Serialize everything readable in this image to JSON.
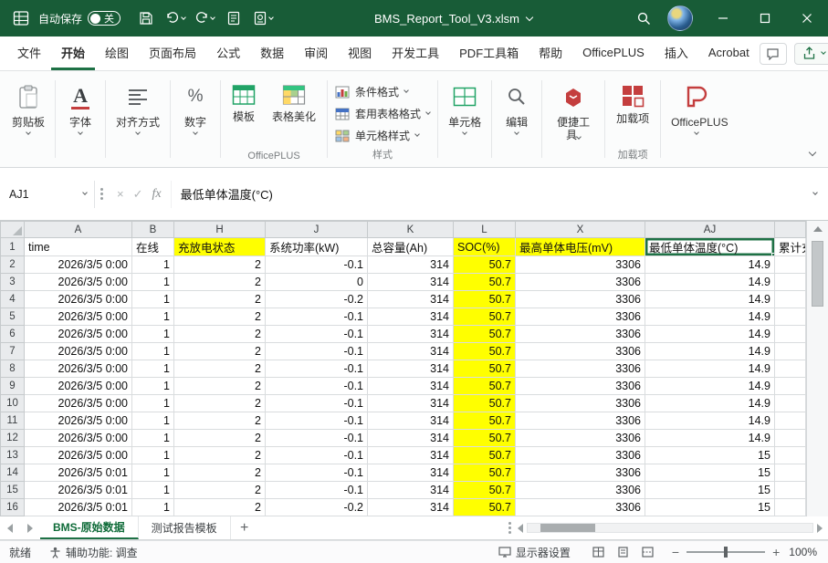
{
  "titlebar": {
    "autosave_label": "自动保存",
    "autosave_state": "关",
    "filename": "BMS_Report_Tool_V3.xlsm"
  },
  "menu": {
    "tabs": [
      "文件",
      "开始",
      "绘图",
      "页面布局",
      "公式",
      "数据",
      "审阅",
      "视图",
      "开发工具",
      "PDF工具箱",
      "帮助",
      "OfficePLUS",
      "插入",
      "Acrobat"
    ],
    "active_tab": "开始"
  },
  "ribbon": {
    "clipboard_label": "剪贴板",
    "font_label": "字体",
    "font_glyph": "A",
    "alignment_label": "对齐方式",
    "number_label": "数字",
    "number_glyph": "%",
    "template_label": "模板",
    "table_beautify_label": "表格美化",
    "officeplus_group_label": "OfficePLUS",
    "conditional_format_label": "条件格式",
    "format_as_table_label": "套用表格格式",
    "cell_styles_label": "单元格样式",
    "styles_group_label": "样式",
    "cells_label": "单元格",
    "editing_label": "编辑",
    "handy_tools_label": "便捷工具",
    "addins_label": "加载项",
    "officeplus_button_label": "OfficePLUS"
  },
  "formula_bar": {
    "name_box": "AJ1",
    "fx_label": "fx",
    "content": "最低单体温度(°C)"
  },
  "grid": {
    "columns": [
      "A",
      "B",
      "H",
      "J",
      "K",
      "L",
      "X",
      "AJ",
      ""
    ],
    "header_row": [
      "time",
      "在线",
      "充放电状态",
      "系统功率(kW)",
      "总容量(Ah)",
      "SOC(%)",
      "最高单体电压(mV)",
      "最低单体温度(°C)",
      "累计充"
    ],
    "rows": [
      {
        "n": 2,
        "cells": [
          "2026/3/5 0:00",
          "1",
          "2",
          "-0.1",
          "314",
          "50.7",
          "3306",
          "14.9",
          ""
        ]
      },
      {
        "n": 3,
        "cells": [
          "2026/3/5 0:00",
          "1",
          "2",
          "0",
          "314",
          "50.7",
          "3306",
          "14.9",
          ""
        ]
      },
      {
        "n": 4,
        "cells": [
          "2026/3/5 0:00",
          "1",
          "2",
          "-0.2",
          "314",
          "50.7",
          "3306",
          "14.9",
          ""
        ]
      },
      {
        "n": 5,
        "cells": [
          "2026/3/5 0:00",
          "1",
          "2",
          "-0.1",
          "314",
          "50.7",
          "3306",
          "14.9",
          ""
        ]
      },
      {
        "n": 6,
        "cells": [
          "2026/3/5 0:00",
          "1",
          "2",
          "-0.1",
          "314",
          "50.7",
          "3306",
          "14.9",
          ""
        ]
      },
      {
        "n": 7,
        "cells": [
          "2026/3/5 0:00",
          "1",
          "2",
          "-0.1",
          "314",
          "50.7",
          "3306",
          "14.9",
          ""
        ]
      },
      {
        "n": 8,
        "cells": [
          "2026/3/5 0:00",
          "1",
          "2",
          "-0.1",
          "314",
          "50.7",
          "3306",
          "14.9",
          ""
        ]
      },
      {
        "n": 9,
        "cells": [
          "2026/3/5 0:00",
          "1",
          "2",
          "-0.1",
          "314",
          "50.7",
          "3306",
          "14.9",
          ""
        ]
      },
      {
        "n": 10,
        "cells": [
          "2026/3/5 0:00",
          "1",
          "2",
          "-0.1",
          "314",
          "50.7",
          "3306",
          "14.9",
          ""
        ]
      },
      {
        "n": 11,
        "cells": [
          "2026/3/5 0:00",
          "1",
          "2",
          "-0.1",
          "314",
          "50.7",
          "3306",
          "14.9",
          ""
        ]
      },
      {
        "n": 12,
        "cells": [
          "2026/3/5 0:00",
          "1",
          "2",
          "-0.1",
          "314",
          "50.7",
          "3306",
          "14.9",
          ""
        ]
      },
      {
        "n": 13,
        "cells": [
          "2026/3/5 0:00",
          "1",
          "2",
          "-0.1",
          "314",
          "50.7",
          "3306",
          "15",
          ""
        ]
      },
      {
        "n": 14,
        "cells": [
          "2026/3/5 0:01",
          "1",
          "2",
          "-0.1",
          "314",
          "50.7",
          "3306",
          "15",
          ""
        ]
      },
      {
        "n": 15,
        "cells": [
          "2026/3/5 0:01",
          "1",
          "2",
          "-0.1",
          "314",
          "50.7",
          "3306",
          "15",
          ""
        ]
      },
      {
        "n": 16,
        "cells": [
          "2026/3/5 0:01",
          "1",
          "2",
          "-0.2",
          "314",
          "50.7",
          "3306",
          "15",
          ""
        ]
      }
    ]
  },
  "sheets": {
    "tabs": [
      "BMS-原始数据",
      "测试报告模板"
    ],
    "active_tab": "BMS-原始数据"
  },
  "status": {
    "ready_label": "就绪",
    "accessibility_label": "辅助功能: 调查",
    "display_settings_label": "显示器设置",
    "zoom_level": "100%"
  },
  "colors": {
    "titlebar_green": "#185c37",
    "accent_green": "#1e7145",
    "highlight_yellow": "#ffff00"
  }
}
